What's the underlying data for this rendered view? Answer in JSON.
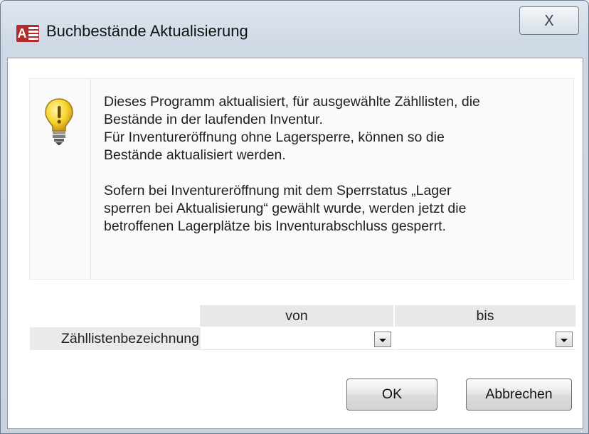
{
  "window": {
    "title": "Buchbestände Aktualisierung",
    "app_icon": "access-app-icon",
    "close_glyph": "X"
  },
  "info": {
    "icon": "lightbulb-icon",
    "message": "Dieses Programm aktualisiert, für ausgewählte Zähllisten,  die\nBestände in der laufenden Inventur.\nFür Inventureröffnung ohne Lagersperre, können so die\nBestände aktualisiert werden.\n\nSofern bei Inventureröffnung mit dem Sperrstatus „Lager\nsperren bei Aktualisierung“ gewählt wurde, werden  jetzt die\nbetroffenen Lagerplätze bis Inventurabschluss gesperrt."
  },
  "range": {
    "label": "Zähllistenbezeichnung",
    "from_header": "von",
    "to_header": "bis",
    "from_value": "",
    "to_value": ""
  },
  "buttons": {
    "ok": "OK",
    "cancel": "Abbrechen"
  },
  "colors": {
    "title_bar": "#cfd9e5",
    "icon_red": "#b62a2a",
    "bulb_yellow": "#f6d32d",
    "header_gray": "#e8e8e8"
  }
}
